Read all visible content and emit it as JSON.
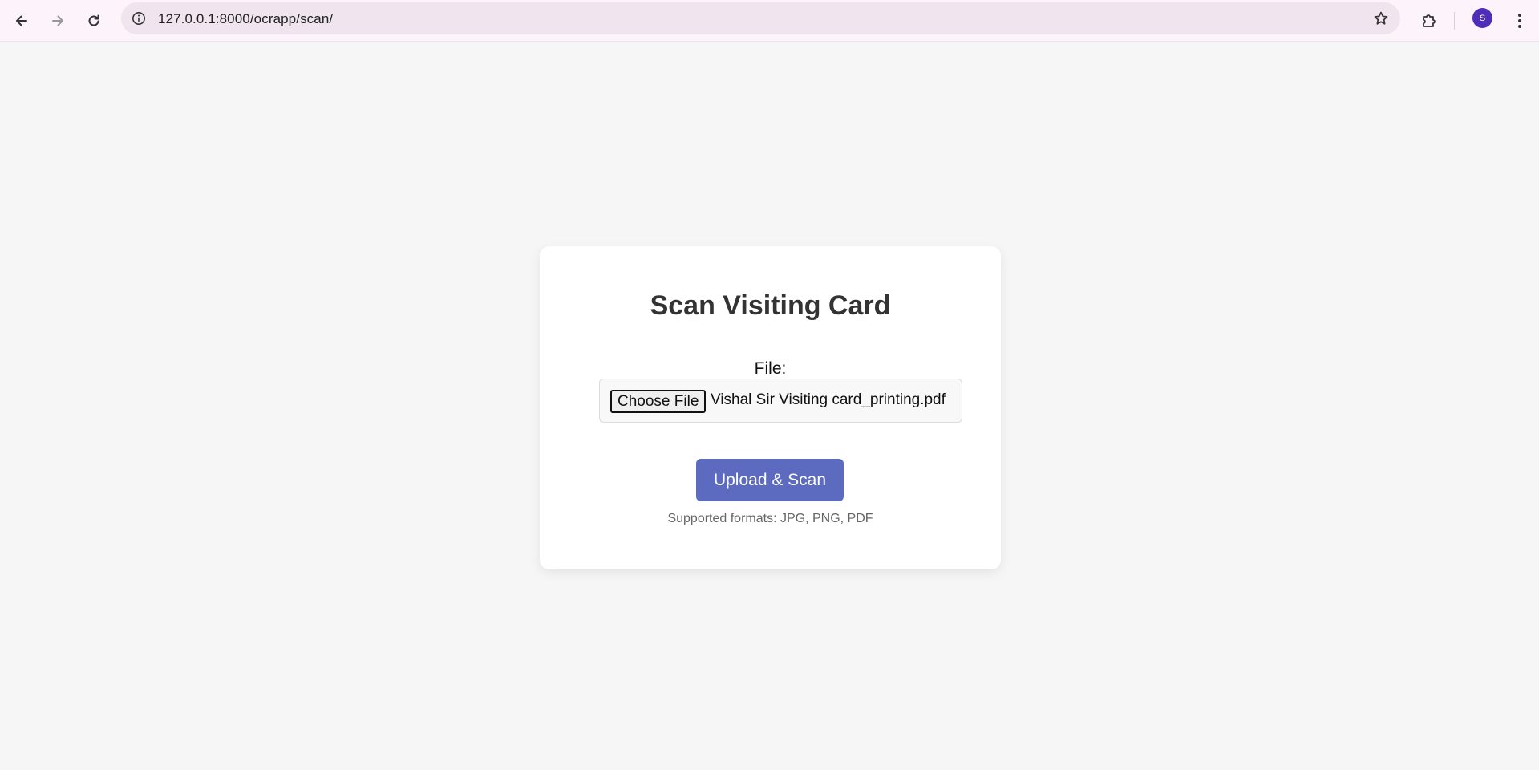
{
  "browser": {
    "url": "127.0.0.1:8000/ocrapp/scan/",
    "profile_initial": "S",
    "icons": {
      "back": "arrow-left-icon",
      "forward": "arrow-right-icon",
      "reload": "reload-icon",
      "site_info": "info-icon",
      "bookmark": "star-icon",
      "extensions": "puzzle-icon",
      "menu": "kebab-menu-icon"
    }
  },
  "page": {
    "title": "Scan Visiting Card",
    "file_label": "File:",
    "choose_file_label": "Choose File",
    "selected_file": "Vishal Sir Visiting card_printing.pdf",
    "submit_label": "Upload & Scan",
    "formats_note": "Supported formats: JPG, PNG, PDF"
  },
  "colors": {
    "page_background": "#f6f6f6",
    "card_background": "#ffffff",
    "button_primary": "#5c6bc0",
    "title_text": "#333333",
    "avatar": "#4e2db8"
  }
}
